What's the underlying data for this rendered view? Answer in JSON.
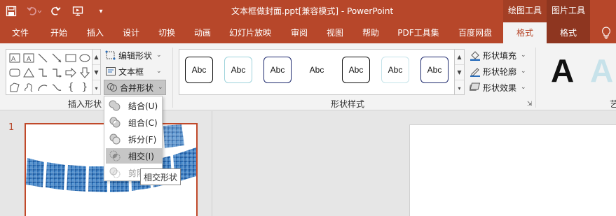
{
  "window": {
    "title": "文本框做封面.ppt[兼容模式]  -  PowerPoint",
    "context_groups": [
      {
        "label": "绘图工具"
      },
      {
        "label": "图片工具"
      }
    ]
  },
  "quick_access": {
    "save_icon": "save-icon",
    "undo_icon": "undo-icon",
    "redo_icon": "redo-icon",
    "present_icon": "start-from-beginning-icon",
    "customize": "▾"
  },
  "tabs": [
    {
      "label": "文件"
    },
    {
      "label": "开始"
    },
    {
      "label": "插入"
    },
    {
      "label": "设计"
    },
    {
      "label": "切换"
    },
    {
      "label": "动画"
    },
    {
      "label": "幻灯片放映"
    },
    {
      "label": "审阅"
    },
    {
      "label": "视图"
    },
    {
      "label": "帮助"
    },
    {
      "label": "PDF工具集"
    },
    {
      "label": "百度网盘"
    },
    {
      "label": "格式"
    },
    {
      "label": "格式"
    }
  ],
  "ribbon": {
    "insert_shapes": {
      "group_label": "插入形状",
      "edit_shape": "编辑形状",
      "text_box": "文本框",
      "merge_shapes": "合并形状"
    },
    "shape_styles": {
      "group_label": "形状样式",
      "swatch_text": "Abc",
      "fill": "形状填充",
      "outline": "形状轮廓",
      "effects": "形状效果"
    },
    "wordart": {
      "letter": "A",
      "group_label_partial": "艺"
    }
  },
  "merge_menu": {
    "items": [
      {
        "label": "结合(U)",
        "icon": "union-icon",
        "state": "normal"
      },
      {
        "label": "组合(C)",
        "icon": "combine-icon",
        "state": "normal"
      },
      {
        "label": "拆分(F)",
        "icon": "fragment-icon",
        "state": "normal"
      },
      {
        "label": "相交(I)",
        "icon": "intersect-icon",
        "state": "hover"
      },
      {
        "label": "剪除",
        "icon": "subtract-icon",
        "state": "disabled"
      }
    ],
    "tooltip": "相交形状"
  },
  "slides_pane": {
    "slide_number": "1"
  },
  "colors": {
    "accent": "#b7472a",
    "ribbon_bg": "#f3f3f3",
    "thumb_border": "#c0492a"
  }
}
